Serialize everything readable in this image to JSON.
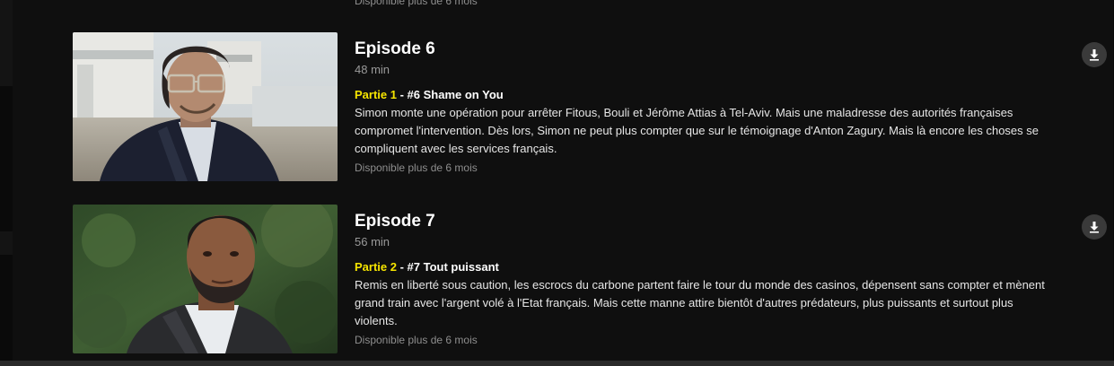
{
  "previous_item": {
    "availability": "Disponible plus de 6 mois"
  },
  "episodes": [
    {
      "title": "Episode 6",
      "duration": "48 min",
      "part_label": "Partie 1",
      "separator": " - ",
      "subtitle": "#6 Shame on You",
      "description": "Simon monte une opération pour arrêter Fitous, Bouli et Jérôme Attias à Tel-Aviv. Mais une maladresse des autorités françaises compromet l'intervention. Dès lors, Simon ne peut plus compter que sur le témoignage d'Anton Zagury. Mais là encore les choses se compliquent avec les services français.",
      "availability": "Disponible plus de 6 mois",
      "thumbnail_icon": "episode-6-thumbnail",
      "download_icon": "download-icon"
    },
    {
      "title": "Episode 7",
      "duration": "56 min",
      "part_label": "Partie 2",
      "separator": " - ",
      "subtitle": "#7 Tout puissant",
      "description": "Remis en liberté sous caution, les escrocs du carbone partent faire le tour du monde des casinos, dépensent sans compter et mènent grand train avec l'argent volé à l'Etat français. Mais cette manne attire bientôt d'autres prédateurs, plus puissants et surtout plus violents.",
      "availability": "Disponible plus de 6 mois",
      "thumbnail_icon": "episode-7-thumbnail",
      "download_icon": "download-icon"
    }
  ],
  "colors": {
    "background": "#0f0f0f",
    "part_accent": "#f5e400",
    "muted_text": "#8e8e8e",
    "download_button": "#3a3a3a"
  }
}
